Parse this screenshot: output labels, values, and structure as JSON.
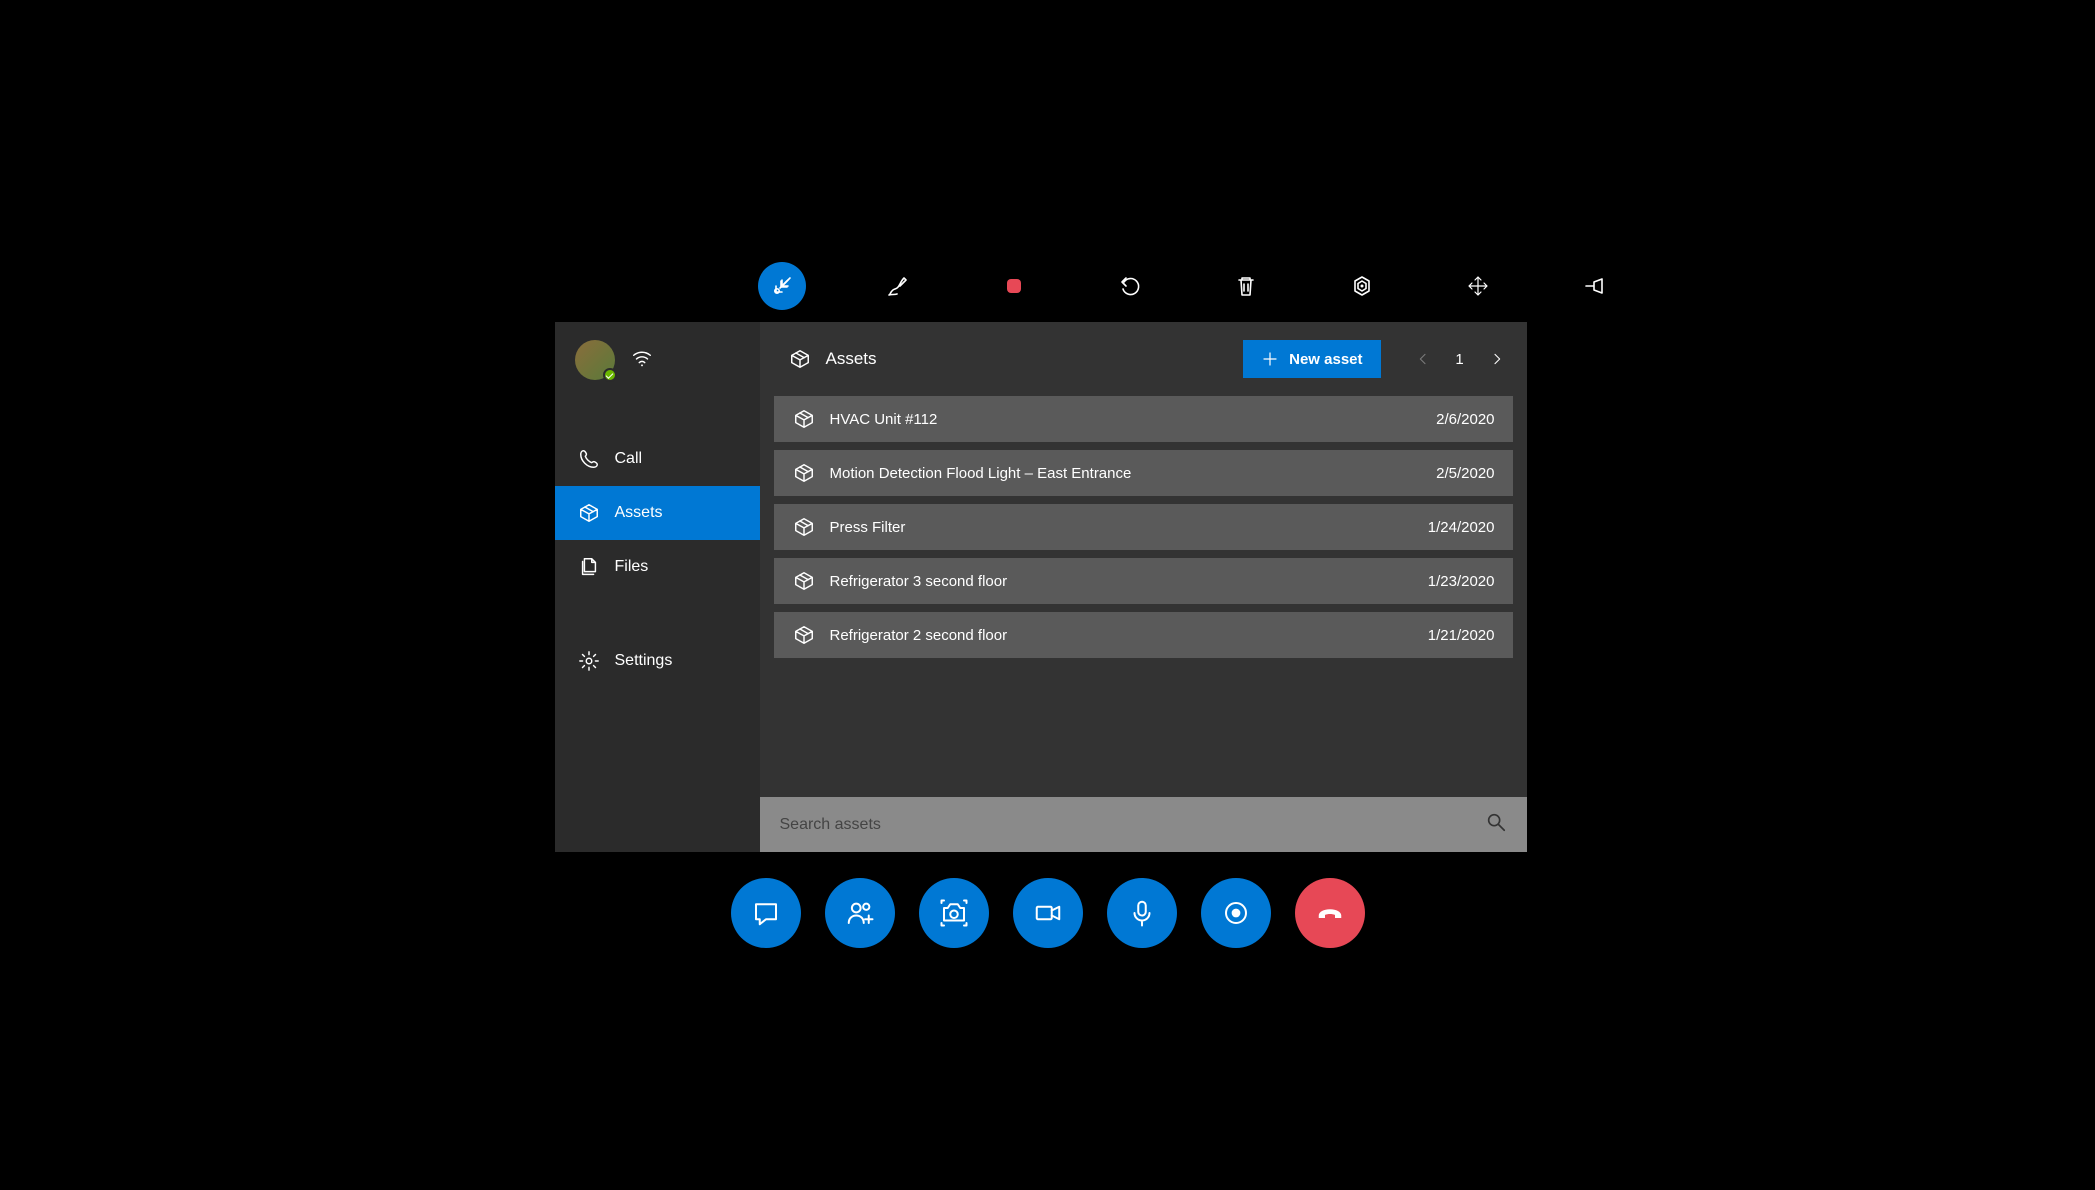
{
  "colors": {
    "accent": "#0078d4",
    "danger": "#e74856"
  },
  "top_toolbar": {
    "items": [
      {
        "name": "minimize-icon",
        "active": true
      },
      {
        "name": "ink-icon"
      },
      {
        "name": "stop-shape-icon"
      },
      {
        "name": "undo-icon"
      },
      {
        "name": "trash-icon"
      },
      {
        "name": "target-icon"
      },
      {
        "name": "move-icon"
      },
      {
        "name": "pin-icon"
      }
    ]
  },
  "sidebar": {
    "items": [
      {
        "icon": "call-icon",
        "label": "Call"
      },
      {
        "icon": "box-icon",
        "label": "Assets",
        "active": true
      },
      {
        "icon": "files-icon",
        "label": "Files"
      },
      {
        "icon": "gear-icon",
        "label": "Settings"
      }
    ]
  },
  "header": {
    "title": "Assets",
    "new_button": "New asset",
    "page": "1"
  },
  "assets": [
    {
      "name": "HVAC Unit #112",
      "date": "2/6/2020"
    },
    {
      "name": "Motion Detection Flood Light – East Entrance",
      "date": "2/5/2020"
    },
    {
      "name": "Press Filter",
      "date": "1/24/2020"
    },
    {
      "name": "Refrigerator 3 second floor",
      "date": "1/23/2020"
    },
    {
      "name": "Refrigerator 2 second floor",
      "date": "1/21/2020"
    }
  ],
  "search": {
    "placeholder": "Search assets"
  },
  "bottom_bar": {
    "items": [
      {
        "name": "chat-icon"
      },
      {
        "name": "add-people-icon"
      },
      {
        "name": "camera-icon"
      },
      {
        "name": "video-icon"
      },
      {
        "name": "mic-icon"
      },
      {
        "name": "record-icon"
      },
      {
        "name": "hangup-icon",
        "red": true
      }
    ]
  }
}
